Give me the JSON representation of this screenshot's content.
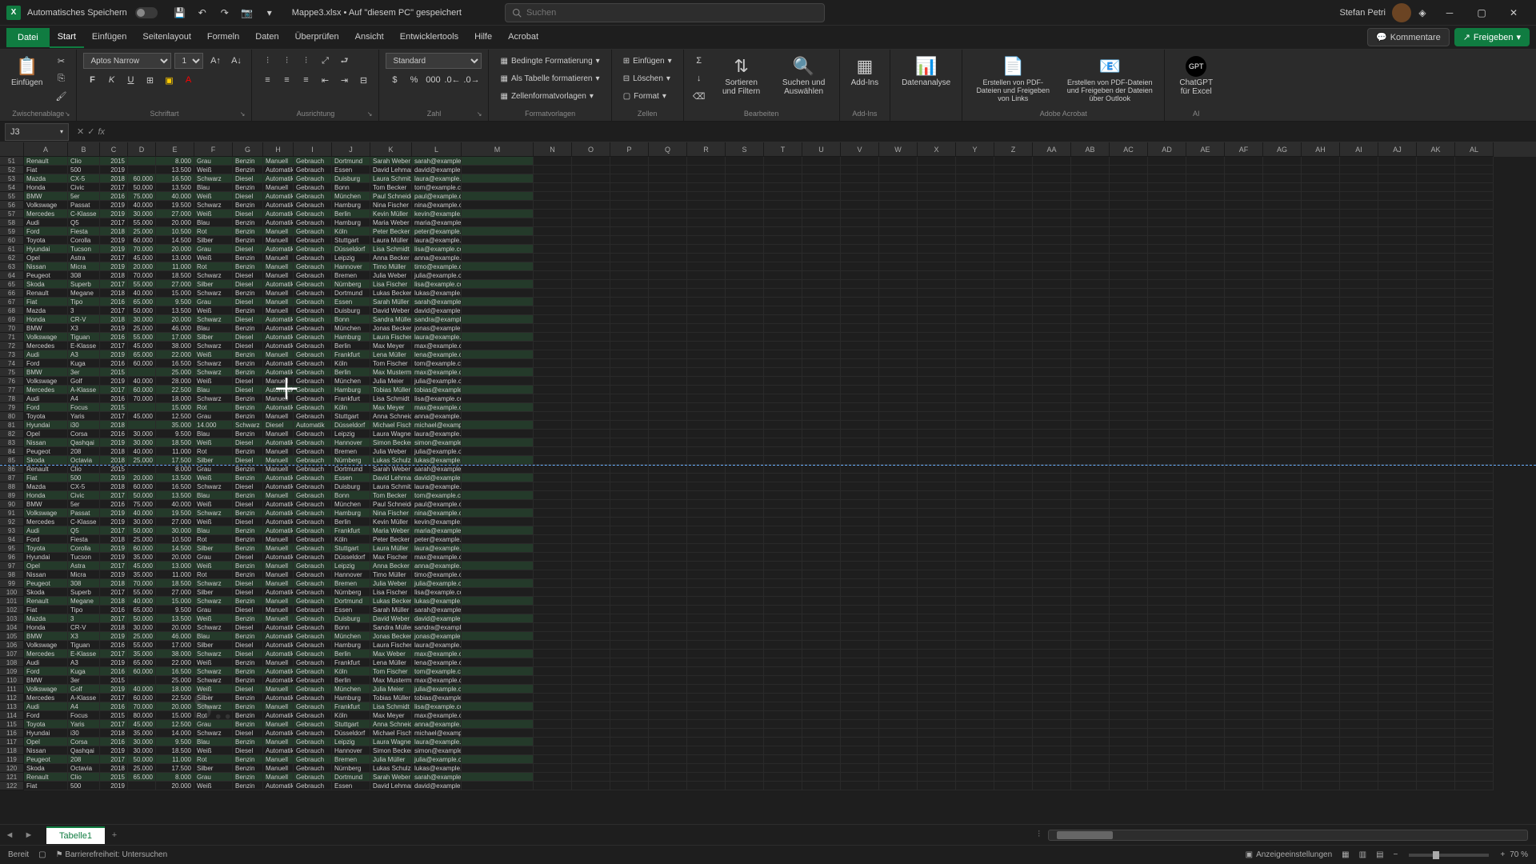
{
  "titlebar": {
    "autosave_label": "Automatisches Speichern",
    "doc_title": "Mappe3.xlsx • Auf \"diesem PC\" gespeichert",
    "search_placeholder": "Suchen",
    "user_name": "Stefan Petri"
  },
  "menu": {
    "file": "Datei",
    "tabs": [
      "Start",
      "Einfügen",
      "Seitenlayout",
      "Formeln",
      "Daten",
      "Überprüfen",
      "Ansicht",
      "Entwicklertools",
      "Hilfe",
      "Acrobat"
    ],
    "active_index": 0,
    "comments": "Kommentare",
    "share": "Freigeben"
  },
  "ribbon": {
    "clipboard": {
      "paste": "Einfügen",
      "label": "Zwischenablage"
    },
    "font": {
      "name": "Aptos Narrow",
      "size": "11",
      "label": "Schriftart"
    },
    "align": {
      "label": "Ausrichtung"
    },
    "number": {
      "format": "Standard",
      "label": "Zahl"
    },
    "styles": {
      "cond": "Bedingte Formatierung",
      "table": "Als Tabelle formatieren",
      "cell": "Zellenformatvorlagen",
      "label": "Formatvorlagen"
    },
    "cells": {
      "insert": "Einfügen",
      "delete": "Löschen",
      "format": "Format",
      "label": "Zellen"
    },
    "editing": {
      "sort": "Sortieren und Filtern",
      "find": "Suchen und Auswählen",
      "label": "Bearbeiten"
    },
    "addins": {
      "btn": "Add-Ins",
      "label": "Add-Ins"
    },
    "analysis": {
      "btn": "Datenanalyse"
    },
    "acrobat": {
      "pdf1": "Erstellen von PDF-Dateien und Freigeben von Links",
      "pdf2": "Erstellen von PDF-Dateien und Freigeben der Dateien über Outlook",
      "label": "Adobe Acrobat"
    },
    "ai": {
      "btn": "ChatGPT für Excel",
      "label": "AI"
    }
  },
  "name_box": "J3",
  "fx_label": "fx",
  "columns": {
    "data": [
      "A",
      "B",
      "C",
      "D",
      "E",
      "F",
      "G",
      "H",
      "I",
      "J",
      "K",
      "L",
      "M"
    ],
    "empty": [
      "N",
      "O",
      "P",
      "Q",
      "R",
      "S",
      "T",
      "U",
      "V",
      "W",
      "X",
      "Y",
      "Z",
      "AA",
      "AB",
      "AC",
      "AD",
      "AE",
      "AF",
      "AG",
      "AH",
      "AI",
      "AJ",
      "AK",
      "AL"
    ],
    "widths": {
      "A": 55,
      "B": 40,
      "C": 35,
      "D": 35,
      "E": 48,
      "F": 48,
      "G": 38,
      "H": 38,
      "I": 48,
      "J": 48,
      "K": 52,
      "L": 62,
      "M": 90
    },
    "empty_width": 48
  },
  "first_row": 51,
  "page_break_after_row": 85,
  "rows": [
    [
      "Renault",
      "Clio",
      "2015",
      "",
      "8.000",
      "Grau",
      "Benzin",
      "Manuell",
      "Gebrauch",
      "Dortmund",
      "Sarah Weber",
      "sarah@example.com"
    ],
    [
      "Fiat",
      "500",
      "2019",
      "",
      "13.500",
      "Weiß",
      "Benzin",
      "Automatik",
      "Gebrauch",
      "Essen",
      "David Lehmann",
      "david@example.com"
    ],
    [
      "Mazda",
      "CX-5",
      "2018",
      "60.000",
      "16.500",
      "Schwarz",
      "Diesel",
      "Automatik",
      "Gebrauch",
      "Duisburg",
      "Laura Schmitz",
      "laura@example.com"
    ],
    [
      "Honda",
      "Civic",
      "2017",
      "50.000",
      "13.500",
      "Blau",
      "Benzin",
      "Manuell",
      "Gebrauch",
      "Bonn",
      "Tom Becker",
      "tom@example.com"
    ],
    [
      "BMW",
      "5er",
      "2016",
      "75.000",
      "40.000",
      "Weiß",
      "Diesel",
      "Automatik",
      "Gebrauch",
      "München",
      "Paul Schneider",
      "paul@example.com"
    ],
    [
      "Volkswage",
      "Passat",
      "2019",
      "40.000",
      "19.500",
      "Schwarz",
      "Benzin",
      "Automatik",
      "Gebrauch",
      "Hamburg",
      "Nina Fischer",
      "nina@example.com"
    ],
    [
      "Mercedes",
      "C-Klasse",
      "2019",
      "30.000",
      "27.000",
      "Weiß",
      "Diesel",
      "Automatik",
      "Gebrauch",
      "Berlin",
      "Kevin Müller",
      "kevin@example.com"
    ],
    [
      "Audi",
      "Q5",
      "2017",
      "55.000",
      "20.000",
      "Blau",
      "Benzin",
      "Automatik",
      "Gebrauch",
      "Hamburg",
      "Maria Weber",
      "maria@example.com"
    ],
    [
      "Ford",
      "Fiesta",
      "2018",
      "25.000",
      "10.500",
      "Rot",
      "Benzin",
      "Manuell",
      "Gebrauch",
      "Köln",
      "Peter Becker",
      "peter@example.com"
    ],
    [
      "Toyota",
      "Corolla",
      "2019",
      "60.000",
      "14.500",
      "Silber",
      "Benzin",
      "Manuell",
      "Gebrauch",
      "Stuttgart",
      "Laura Müller",
      "laura@example.com"
    ],
    [
      "Hyundai",
      "Tucson",
      "2019",
      "70.000",
      "20.000",
      "Grau",
      "Diesel",
      "Automatik",
      "Gebrauch",
      "Düsseldorf",
      "Lisa Schmidt",
      "lisa@example.com"
    ],
    [
      "Opel",
      "Astra",
      "2017",
      "45.000",
      "13.000",
      "Weiß",
      "Benzin",
      "Manuell",
      "Gebrauch",
      "Leipzig",
      "Anna Becker",
      "anna@example.com"
    ],
    [
      "Nissan",
      "Micra",
      "2019",
      "20.000",
      "11.000",
      "Rot",
      "Benzin",
      "Manuell",
      "Gebrauch",
      "Hannover",
      "Timo Müller",
      "timo@example.com"
    ],
    [
      "Peugeot",
      "308",
      "2018",
      "70.000",
      "18.500",
      "Schwarz",
      "Diesel",
      "Manuell",
      "Gebrauch",
      "Bremen",
      "Julia Weber",
      "julia@example.com"
    ],
    [
      "Skoda",
      "Superb",
      "2017",
      "55.000",
      "27.000",
      "Silber",
      "Diesel",
      "Automatik",
      "Gebrauch",
      "Nürnberg",
      "Lisa Fischer",
      "lisa@example.com"
    ],
    [
      "Renault",
      "Megane",
      "2018",
      "40.000",
      "15.000",
      "Schwarz",
      "Benzin",
      "Manuell",
      "Gebrauch",
      "Dortmund",
      "Lukas Becker",
      "lukas@example.com"
    ],
    [
      "Fiat",
      "Tipo",
      "2016",
      "65.000",
      "9.500",
      "Grau",
      "Diesel",
      "Manuell",
      "Gebrauch",
      "Essen",
      "Sarah Müller",
      "sarah@example.com"
    ],
    [
      "Mazda",
      "3",
      "2017",
      "50.000",
      "13.500",
      "Weiß",
      "Benzin",
      "Manuell",
      "Gebrauch",
      "Duisburg",
      "David Weber",
      "david@example.com"
    ],
    [
      "Honda",
      "CR-V",
      "2018",
      "30.000",
      "20.000",
      "Schwarz",
      "Diesel",
      "Automatik",
      "Gebrauch",
      "Bonn",
      "Sandra Müller",
      "sandra@example.com"
    ],
    [
      "BMW",
      "X3",
      "2019",
      "25.000",
      "46.000",
      "Blau",
      "Benzin",
      "Automatik",
      "Gebrauch",
      "München",
      "Jonas Becker",
      "jonas@example.com"
    ],
    [
      "Volkswage",
      "Tiguan",
      "2016",
      "55.000",
      "17.000",
      "Silber",
      "Diesel",
      "Automatik",
      "Gebrauch",
      "Hamburg",
      "Laura Fischer",
      "laura@example.com"
    ],
    [
      "Mercedes",
      "E-Klasse",
      "2017",
      "45.000",
      "38.000",
      "Schwarz",
      "Diesel",
      "Automatik",
      "Gebrauch",
      "Berlin",
      "Max Meyer",
      "max@example.com"
    ],
    [
      "Audi",
      "A3",
      "2019",
      "65.000",
      "22.000",
      "Weiß",
      "Benzin",
      "Manuell",
      "Gebrauch",
      "Frankfurt",
      "Lena Müller",
      "lena@example.com"
    ],
    [
      "Ford",
      "Kuga",
      "2016",
      "60.000",
      "16.500",
      "Schwarz",
      "Benzin",
      "Automatik",
      "Gebrauch",
      "Köln",
      "Tom Fischer",
      "tom@example.com"
    ],
    [
      "BMW",
      "3er",
      "2015",
      "",
      "25.000",
      "Schwarz",
      "Benzin",
      "Automatik",
      "Gebrauch",
      "Berlin",
      "Max Musterma",
      "max@example.com"
    ],
    [
      "Volkswage",
      "Golf",
      "2019",
      "40.000",
      "28.000",
      "Weiß",
      "Diesel",
      "Manuell",
      "Gebrauch",
      "München",
      "Julia Meier",
      "julia@example.com"
    ],
    [
      "Mercedes",
      "A-Klasse",
      "2017",
      "60.000",
      "22.500",
      "Blau",
      "Diesel",
      "Automatik",
      "Gebrauch",
      "Hamburg",
      "Tobias Müller",
      "tobias@example.com"
    ],
    [
      "Audi",
      "A4",
      "2016",
      "70.000",
      "18.000",
      "Schwarz",
      "Benzin",
      "Manuell",
      "Gebrauch",
      "Frankfurt",
      "Lisa Schmidt",
      "lisa@example.com"
    ],
    [
      "Ford",
      "Focus",
      "2015",
      "",
      "15.000",
      "Rot",
      "Benzin",
      "Automatik",
      "Gebrauch",
      "Köln",
      "Max Meyer",
      "max@example.com"
    ],
    [
      "Toyota",
      "Yaris",
      "2017",
      "45.000",
      "12.500",
      "Grau",
      "Benzin",
      "Manuell",
      "Gebrauch",
      "Stuttgart",
      "Anna Schneider",
      "anna@example.com"
    ],
    [
      "Hyundai",
      "i30",
      "2018",
      "",
      "35.000",
      "14.000",
      "Schwarz",
      "Diesel",
      "Automatik",
      "Düsseldorf",
      "Michael Fischer",
      "michael@example.com"
    ],
    [
      "Opel",
      "Corsa",
      "2016",
      "30.000",
      "9.500",
      "Blau",
      "Benzin",
      "Manuell",
      "Gebrauch",
      "Leipzig",
      "Laura Wagner",
      "laura@example.com"
    ],
    [
      "Nissan",
      "Qashqai",
      "2019",
      "30.000",
      "18.500",
      "Weiß",
      "Diesel",
      "Automatik",
      "Gebrauch",
      "Hannover",
      "Simon Becker",
      "simon@example.com"
    ],
    [
      "Peugeot",
      "208",
      "2018",
      "40.000",
      "11.000",
      "Rot",
      "Benzin",
      "Manuell",
      "Gebrauch",
      "Bremen",
      "Julia Weber",
      "julia@example.com"
    ],
    [
      "Skoda",
      "Octavia",
      "2018",
      "25.000",
      "17.500",
      "Silber",
      "Diesel",
      "Manuell",
      "Gebrauch",
      "Nürnberg",
      "Lukas Schulz",
      "lukas@example.com"
    ],
    [
      "Renault",
      "Clio",
      "2015",
      "",
      "8.000",
      "Grau",
      "Benzin",
      "Manuell",
      "Gebrauch",
      "Dortmund",
      "Sarah Weber",
      "sarah@example.com"
    ],
    [
      "Fiat",
      "500",
      "2019",
      "20.000",
      "13.500",
      "Weiß",
      "Benzin",
      "Automatik",
      "Gebrauch",
      "Essen",
      "David Lehmann",
      "david@example.com"
    ],
    [
      "Mazda",
      "CX-5",
      "2018",
      "60.000",
      "16.500",
      "Schwarz",
      "Diesel",
      "Automatik",
      "Gebrauch",
      "Duisburg",
      "Laura Schmitz",
      "laura@example.com"
    ],
    [
      "Honda",
      "Civic",
      "2017",
      "50.000",
      "13.500",
      "Blau",
      "Benzin",
      "Manuell",
      "Gebrauch",
      "Bonn",
      "Tom Becker",
      "tom@example.com"
    ],
    [
      "BMW",
      "5er",
      "2016",
      "75.000",
      "40.000",
      "Weiß",
      "Diesel",
      "Automatik",
      "Gebrauch",
      "München",
      "Paul Schneider",
      "paul@example.com"
    ],
    [
      "Volkswage",
      "Passat",
      "2019",
      "40.000",
      "19.500",
      "Schwarz",
      "Benzin",
      "Automatik",
      "Gebrauch",
      "Hamburg",
      "Nina Fischer",
      "nina@example.com"
    ],
    [
      "Mercedes",
      "C-Klasse",
      "2019",
      "30.000",
      "27.000",
      "Weiß",
      "Diesel",
      "Automatik",
      "Gebrauch",
      "Berlin",
      "Kevin Müller",
      "kevin@example.com"
    ],
    [
      "Audi",
      "Q5",
      "2017",
      "50.000",
      "30.000",
      "Blau",
      "Benzin",
      "Automatik",
      "Gebrauch",
      "Frankfurt",
      "Maria Weber",
      "maria@example.com"
    ],
    [
      "Ford",
      "Fiesta",
      "2018",
      "25.000",
      "10.500",
      "Rot",
      "Benzin",
      "Manuell",
      "Gebrauch",
      "Köln",
      "Peter Becker",
      "peter@example.com"
    ],
    [
      "Toyota",
      "Corolla",
      "2019",
      "60.000",
      "14.500",
      "Silber",
      "Benzin",
      "Manuell",
      "Gebrauch",
      "Stuttgart",
      "Laura Müller",
      "laura@example.com"
    ],
    [
      "Hyundai",
      "Tucson",
      "2019",
      "35.000",
      "20.000",
      "Grau",
      "Diesel",
      "Automatik",
      "Gebrauch",
      "Düsseldorf",
      "Max Fischer",
      "max@example.com"
    ],
    [
      "Opel",
      "Astra",
      "2017",
      "45.000",
      "13.000",
      "Weiß",
      "Benzin",
      "Manuell",
      "Gebrauch",
      "Leipzig",
      "Anna Becker",
      "anna@example.com"
    ],
    [
      "Nissan",
      "Micra",
      "2019",
      "35.000",
      "11.000",
      "Rot",
      "Benzin",
      "Manuell",
      "Gebrauch",
      "Hannover",
      "Timo Müller",
      "timo@example.com"
    ],
    [
      "Peugeot",
      "308",
      "2018",
      "70.000",
      "18.500",
      "Schwarz",
      "Diesel",
      "Manuell",
      "Gebrauch",
      "Bremen",
      "Julia Weber",
      "julia@example.com"
    ],
    [
      "Skoda",
      "Superb",
      "2017",
      "55.000",
      "27.000",
      "Silber",
      "Diesel",
      "Automatik",
      "Gebrauch",
      "Nürnberg",
      "Lisa Fischer",
      "lisa@example.com"
    ],
    [
      "Renault",
      "Megane",
      "2018",
      "40.000",
      "15.000",
      "Schwarz",
      "Benzin",
      "Manuell",
      "Gebrauch",
      "Dortmund",
      "Lukas Becker",
      "lukas@example.com"
    ],
    [
      "Fiat",
      "Tipo",
      "2016",
      "65.000",
      "9.500",
      "Grau",
      "Diesel",
      "Manuell",
      "Gebrauch",
      "Essen",
      "Sarah Müller",
      "sarah@example.com"
    ],
    [
      "Mazda",
      "3",
      "2017",
      "50.000",
      "13.500",
      "Weiß",
      "Benzin",
      "Manuell",
      "Gebrauch",
      "Duisburg",
      "David Weber",
      "david@example.com"
    ],
    [
      "Honda",
      "CR-V",
      "2018",
      "30.000",
      "20.000",
      "Schwarz",
      "Diesel",
      "Automatik",
      "Gebrauch",
      "Bonn",
      "Sandra Müller",
      "sandra@example.com"
    ],
    [
      "BMW",
      "X3",
      "2019",
      "25.000",
      "46.000",
      "Blau",
      "Benzin",
      "Automatik",
      "Gebrauch",
      "München",
      "Jonas Becker",
      "jonas@example.com"
    ],
    [
      "Volkswage",
      "Tiguan",
      "2016",
      "55.000",
      "17.000",
      "Silber",
      "Diesel",
      "Automatik",
      "Gebrauch",
      "Hamburg",
      "Laura Fischer",
      "laura@example.com"
    ],
    [
      "Mercedes",
      "E-Klasse",
      "2017",
      "35.000",
      "38.000",
      "Schwarz",
      "Diesel",
      "Automatik",
      "Gebrauch",
      "Berlin",
      "Max Weber",
      "max@example.com"
    ],
    [
      "Audi",
      "A3",
      "2019",
      "65.000",
      "22.000",
      "Weiß",
      "Benzin",
      "Manuell",
      "Gebrauch",
      "Frankfurt",
      "Lena Müller",
      "lena@example.com"
    ],
    [
      "Ford",
      "Kuga",
      "2016",
      "60.000",
      "16.500",
      "Schwarz",
      "Benzin",
      "Automatik",
      "Gebrauch",
      "Köln",
      "Tom Fischer",
      "tom@example.com"
    ],
    [
      "BMW",
      "3er",
      "2015",
      "",
      "25.000",
      "Schwarz",
      "Benzin",
      "Automatik",
      "Gebrauch",
      "Berlin",
      "Max Musterma",
      "max@example.com"
    ],
    [
      "Volkswage",
      "Golf",
      "2019",
      "40.000",
      "18.000",
      "Weiß",
      "Diesel",
      "Manuell",
      "Gebrauch",
      "München",
      "Julia Meier",
      "julia@example.com"
    ],
    [
      "Mercedes",
      "A-Klasse",
      "2017",
      "60.000",
      "22.500",
      "Silber",
      "Benzin",
      "Automatik",
      "Gebrauch",
      "Hamburg",
      "Tobias Müller",
      "tobias@example.com"
    ],
    [
      "Audi",
      "A4",
      "2016",
      "70.000",
      "20.000",
      "Schwarz",
      "Benzin",
      "Manuell",
      "Gebrauch",
      "Frankfurt",
      "Lisa Schmidt",
      "lisa@example.com"
    ],
    [
      "Ford",
      "Focus",
      "2015",
      "80.000",
      "15.000",
      "Rot",
      "Benzin",
      "Automatik",
      "Gebrauch",
      "Köln",
      "Max Meyer",
      "max@example.com"
    ],
    [
      "Toyota",
      "Yaris",
      "2017",
      "45.000",
      "12.500",
      "Grau",
      "Benzin",
      "Manuell",
      "Gebrauch",
      "Stuttgart",
      "Anna Schneider",
      "anna@example.com"
    ],
    [
      "Hyundai",
      "i30",
      "2018",
      "35.000",
      "14.000",
      "Schwarz",
      "Diesel",
      "Automatik",
      "Gebrauch",
      "Düsseldorf",
      "Michael Fischer",
      "michael@example.com"
    ],
    [
      "Opel",
      "Corsa",
      "2016",
      "30.000",
      "9.500",
      "Blau",
      "Benzin",
      "Manuell",
      "Gebrauch",
      "Leipzig",
      "Laura Wagner",
      "laura@example.com"
    ],
    [
      "Nissan",
      "Qashqai",
      "2019",
      "30.000",
      "18.500",
      "Weiß",
      "Diesel",
      "Automatik",
      "Gebrauch",
      "Hannover",
      "Simon Becker",
      "simon@example.com"
    ],
    [
      "Peugeot",
      "208",
      "2017",
      "50.000",
      "11.000",
      "Rot",
      "Benzin",
      "Manuell",
      "Gebrauch",
      "Bremen",
      "Julia Müller",
      "julia@example.com"
    ],
    [
      "Skoda",
      "Octavia",
      "2018",
      "25.000",
      "17.500",
      "Silber",
      "Benzin",
      "Manuell",
      "Gebrauch",
      "Nürnberg",
      "Lukas Schulz",
      "lukas@example.com"
    ],
    [
      "Renault",
      "Clio",
      "2015",
      "65.000",
      "8.000",
      "Grau",
      "Benzin",
      "Manuell",
      "Gebrauch",
      "Dortmund",
      "Sarah Weber",
      "sarah@example.com"
    ],
    [
      "Fiat",
      "500",
      "2019",
      "",
      "20.000",
      "Weiß",
      "Benzin",
      "Automatik",
      "Gebrauch",
      "Essen",
      "David Lehmann",
      "david@example.com"
    ]
  ],
  "sheet_tabs": {
    "active": "Tabelle1"
  },
  "statusbar": {
    "ready": "Bereit",
    "accessibility": "Barrierefreiheit: Untersuchen",
    "display": "Anzeigeeinstellungen",
    "zoom": "70 %"
  },
  "watermark": "S..."
}
